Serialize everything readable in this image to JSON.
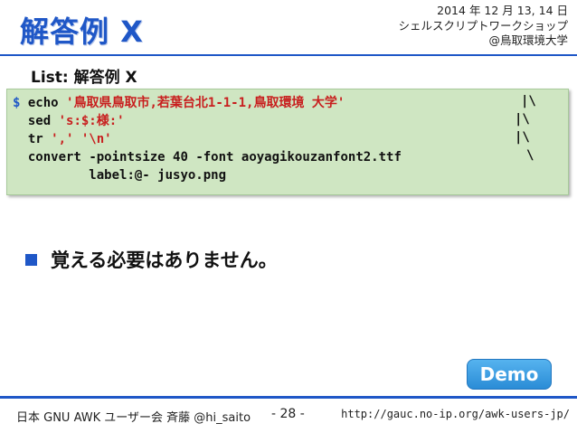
{
  "title": "解答例 X",
  "event": {
    "date": "2014 年 12 月 13, 14 日",
    "name": "シェルスクリプトワークショップ",
    "place": "@鳥取環境大学"
  },
  "list_label": "List: 解答例 X",
  "code": {
    "prompt": "$",
    "lines": [
      {
        "cmd": "echo",
        "arg": "'鳥取県鳥取市,若葉台北1-1-1,鳥取環境 大学'",
        "cont": "|\\"
      },
      {
        "cmd": "sed",
        "arg": "'s:$:様:'",
        "cont": "|\\"
      },
      {
        "cmd": "tr",
        "arg": "',' '\\n'",
        "cont": "|\\"
      },
      {
        "cmd": "convert",
        "arg": "-pointsize 40 -font aoyagikouzanfont2.ttf",
        "cont": "\\"
      },
      {
        "cmd": "label:@- jusyo.png",
        "arg": "",
        "cont": ""
      }
    ]
  },
  "bullet": "覚える必要はありません。",
  "demo_button": "Demo",
  "footer": {
    "left": "日本 GNU AWK ユーザー会 斉藤 @hi_saito",
    "page": "- 28 -",
    "url": "http://gauc.no-ip.org/awk-users-jp/"
  },
  "colors": {
    "accent": "#1f57c7",
    "code_bg": "#cfe6c2",
    "string": "#c81e1e",
    "demo": "#3a9ee6"
  }
}
